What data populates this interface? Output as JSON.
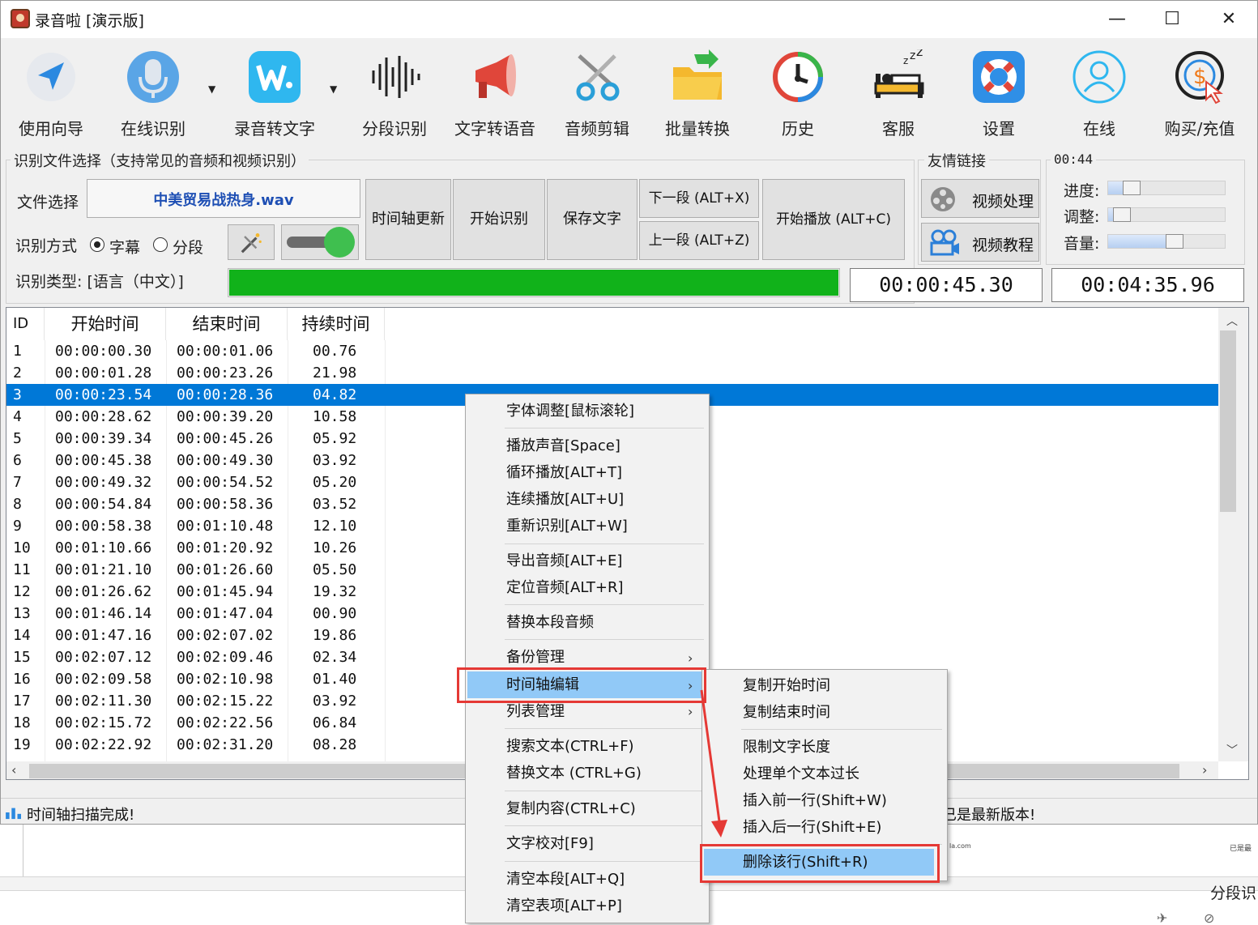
{
  "window": {
    "title": "录音啦 [演示版]",
    "minimize": "—",
    "maximize": "☐",
    "close": "✕"
  },
  "toolbar": [
    {
      "label": "使用向导",
      "icon": "navigation-arrow-icon"
    },
    {
      "label": "在线识别",
      "icon": "microphone-icon"
    },
    {
      "label": "录音转文字",
      "icon": "wav-file-icon"
    },
    {
      "label": "分段识别",
      "icon": "waveform-icon"
    },
    {
      "label": "文字转语音",
      "icon": "megaphone-icon"
    },
    {
      "label": "音频剪辑",
      "icon": "scissors-icon"
    },
    {
      "label": "批量转换",
      "icon": "folder-icon"
    },
    {
      "label": "历史",
      "icon": "history-clock-icon"
    },
    {
      "label": "客服",
      "icon": "sleeping-bed-icon"
    },
    {
      "label": "设置",
      "icon": "lifebuoy-icon"
    },
    {
      "label": "在线",
      "icon": "user-icon"
    },
    {
      "label": "购买/充值",
      "icon": "dollar-cursor-icon"
    }
  ],
  "recog_group": {
    "legend": "识别文件选择（支持常见的音频和视频识别）",
    "file_label": "文件选择",
    "file_name": "中美贸易战热身.wav",
    "mode_label": "识别方式",
    "mode_subtitle": "字幕",
    "mode_segment": "分段",
    "type_label": "识别类型: [语言（中文）]",
    "progress": 1.0
  },
  "buttons": {
    "timeline_update": "时间轴更新",
    "start_recog": "开始识别",
    "save_text": "保存文字",
    "next_seg": "下一段 (ALT+X)",
    "prev_seg": "上一段 (ALT+Z)",
    "start_play": "开始播放 (ALT+C)"
  },
  "links": {
    "legend": "友情链接",
    "video_process": "视频处理",
    "video_tutorial": "视频教程"
  },
  "controls": {
    "legend": "00:44",
    "progress_label": "进度:",
    "adjust_label": "调整:",
    "volume_label": "音量:",
    "progress_value": 0.15,
    "adjust_value": 0.05,
    "volume_value": 0.58
  },
  "times": {
    "current": "00:00:45.30",
    "total": "00:04:35.96"
  },
  "table": {
    "headers": [
      "ID",
      "开始时间",
      "结束时间",
      "持续时间"
    ],
    "rows": [
      [
        "1",
        "00:00:00.30",
        "00:00:01.06",
        "00.76"
      ],
      [
        "2",
        "00:00:01.28",
        "00:00:23.26",
        "21.98"
      ],
      [
        "3",
        "00:00:23.54",
        "00:00:28.36",
        "04.82"
      ],
      [
        "4",
        "00:00:28.62",
        "00:00:39.20",
        "10.58"
      ],
      [
        "5",
        "00:00:39.34",
        "00:00:45.26",
        "05.92"
      ],
      [
        "6",
        "00:00:45.38",
        "00:00:49.30",
        "03.92"
      ],
      [
        "7",
        "00:00:49.32",
        "00:00:54.52",
        "05.20"
      ],
      [
        "8",
        "00:00:54.84",
        "00:00:58.36",
        "03.52"
      ],
      [
        "9",
        "00:00:58.38",
        "00:01:10.48",
        "12.10"
      ],
      [
        "10",
        "00:01:10.66",
        "00:01:20.92",
        "10.26"
      ],
      [
        "11",
        "00:01:21.10",
        "00:01:26.60",
        "05.50"
      ],
      [
        "12",
        "00:01:26.62",
        "00:01:45.94",
        "19.32"
      ],
      [
        "13",
        "00:01:46.14",
        "00:01:47.04",
        "00.90"
      ],
      [
        "14",
        "00:01:47.16",
        "00:02:07.02",
        "19.86"
      ],
      [
        "15",
        "00:02:07.12",
        "00:02:09.46",
        "02.34"
      ],
      [
        "16",
        "00:02:09.58",
        "00:02:10.98",
        "01.40"
      ],
      [
        "17",
        "00:02:11.30",
        "00:02:15.22",
        "03.92"
      ],
      [
        "18",
        "00:02:15.72",
        "00:02:22.56",
        "06.84"
      ],
      [
        "19",
        "00:02:22.92",
        "00:02:31.20",
        "08.28"
      ]
    ],
    "selected_row": "3"
  },
  "status": {
    "left": "时间轴扫描完成!",
    "right": "已是最新版本!"
  },
  "context_menu": [
    {
      "label": "字体调整[鼠标滚轮]"
    },
    {
      "label": "播放声音[Space]"
    },
    {
      "label": "循环播放[ALT+T]"
    },
    {
      "label": "连续播放[ALT+U]"
    },
    {
      "label": "重新识别[ALT+W]"
    },
    {
      "label": "导出音频[ALT+E]"
    },
    {
      "label": "定位音频[ALT+R]"
    },
    {
      "label": "替换本段音频"
    },
    {
      "label": "备份管理"
    },
    {
      "label": "时间轴编辑"
    },
    {
      "label": "列表管理"
    },
    {
      "label": "搜索文本(CTRL+F)"
    },
    {
      "label": "替换文本 (CTRL+G)"
    },
    {
      "label": "复制内容(CTRL+C)"
    },
    {
      "label": "文字校对[F9]"
    },
    {
      "label": "清空本段[ALT+Q]"
    },
    {
      "label": "清空表项[ALT+P]"
    }
  ],
  "submenu": [
    {
      "label": "复制开始时间"
    },
    {
      "label": "复制结束时间"
    },
    {
      "label": "限制文字长度"
    },
    {
      "label": "处理单个文本过长"
    },
    {
      "label": "插入前一行(Shift+W)"
    },
    {
      "label": "插入后一行(Shift+E)"
    },
    {
      "label": "删除该行(Shift+R)"
    }
  ],
  "background_window": {
    "label": "分段识",
    "small_url": "la.com",
    "small_status": "已是最"
  },
  "colors": {
    "selection": "#0078d7",
    "menu_highlight": "#91c9f7",
    "progress": "#11b21a",
    "annotation": "#e53935"
  }
}
